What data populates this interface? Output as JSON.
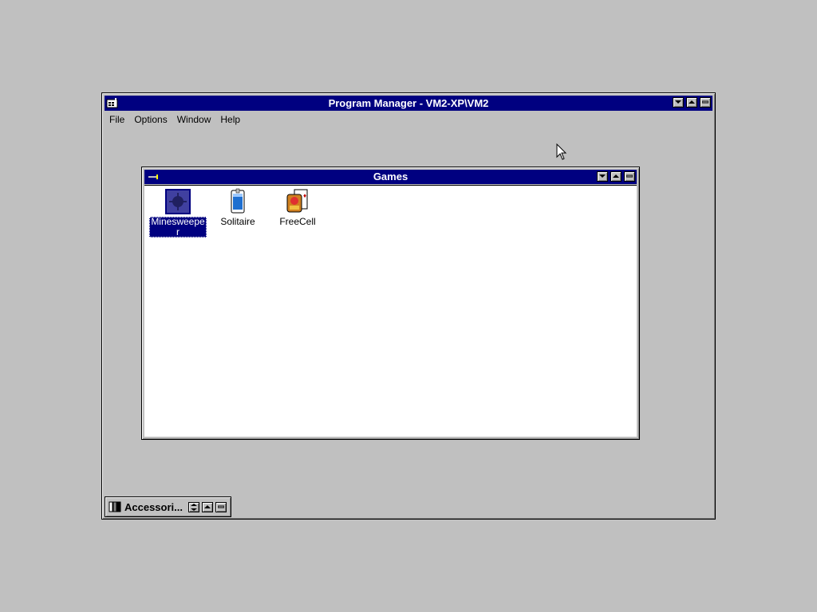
{
  "program_manager": {
    "title": "Program Manager - VM2-XP\\VM2",
    "menu": [
      {
        "label": "File"
      },
      {
        "label": "Options"
      },
      {
        "label": "Window"
      },
      {
        "label": "Help"
      }
    ]
  },
  "games_group": {
    "title": "Games",
    "icons": [
      {
        "label": "Minesweeper",
        "icon": "minesweeper-icon",
        "selected": true
      },
      {
        "label": "Solitaire",
        "icon": "solitaire-icon",
        "selected": false
      },
      {
        "label": "FreeCell",
        "icon": "freecell-icon",
        "selected": false
      }
    ]
  },
  "minimized_groups": [
    {
      "label": "Accessori...",
      "icon": "program-group-icon"
    }
  ],
  "colors": {
    "desktop": "#c0c0c0",
    "titlebar_active": "#000080",
    "selection": "#000080",
    "client": "#ffffff"
  }
}
